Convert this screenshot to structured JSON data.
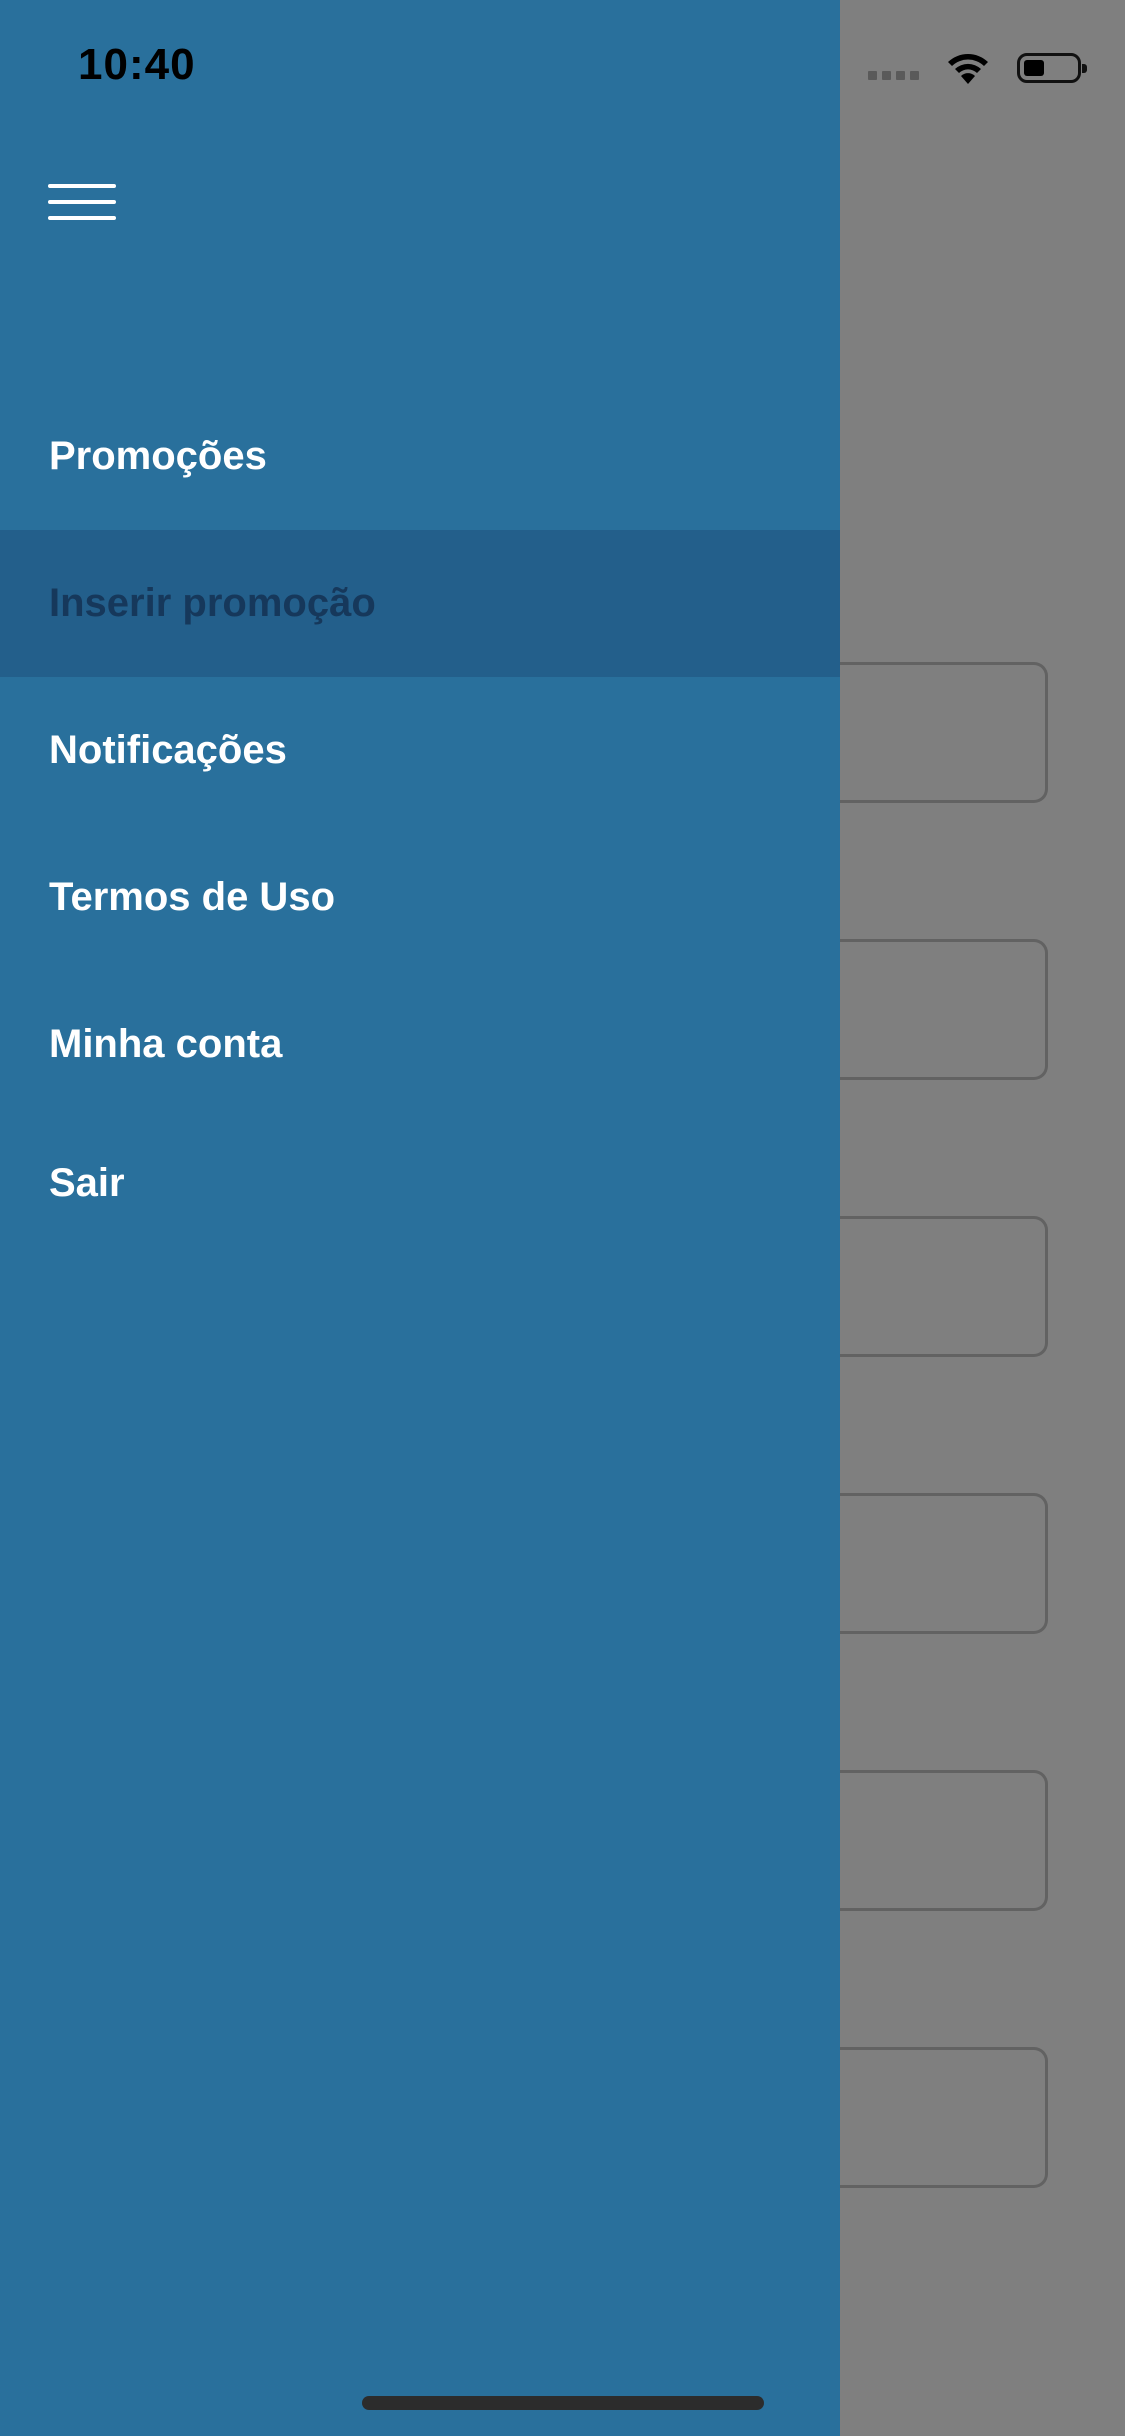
{
  "status_bar": {
    "time": "10:40"
  },
  "icons": {
    "menu": "hamburger-icon",
    "wifi": "wifi-icon",
    "battery": "battery-icon",
    "signal": "signal-icon"
  },
  "drawer": {
    "items": [
      {
        "label": "Promoções",
        "active": false
      },
      {
        "label": "Inserir promoção",
        "active": true
      },
      {
        "label": "Notificações",
        "active": false
      },
      {
        "label": "Termos de Uso",
        "active": false
      },
      {
        "label": "Minha conta",
        "active": false
      },
      {
        "label": "Sair",
        "active": false
      }
    ]
  },
  "colors": {
    "drawer_bg": "#29709c",
    "active_item_bg": "#235f8b",
    "active_item_text": "#16385b",
    "overlay": "#7f7f7f"
  }
}
